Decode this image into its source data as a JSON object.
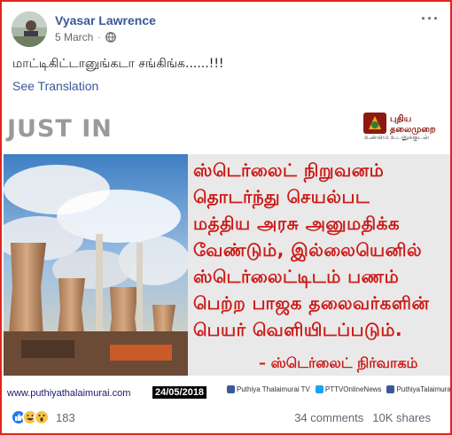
{
  "post": {
    "author": "Vyasar Lawrence",
    "date": "5 March",
    "privacy_icon": "globe-icon",
    "menu_icon": "more-options-icon",
    "text": "மாட்டிகிட்டானுங்கடா சங்கிங்க......!!!",
    "see_translation": "See Translation"
  },
  "image": {
    "just_in": "JUST IN",
    "logo_line1": "புதிய",
    "logo_line2": "தலைமுறை",
    "logo_sub": "உண்மை உடனுக்குடன்",
    "quote_lines": [
      "ஸ்டெர்லைட் நிறுவனம்",
      "தொடர்ந்து செயல்பட",
      "மத்திய அரசு அனுமதிக்க",
      "வேண்டும், இல்லையெனில்",
      "ஸ்டெர்லைட்டிடம் பணம்",
      "பெற்ற பாஜக தலைவர்களின்",
      "பெயர் வெளியிடப்படும்."
    ],
    "attribution": "– ஸ்டெர்லைட் நிர்வாகம்",
    "website": "www.puthiyathalaimurai.com",
    "date_badge": "24/05/2018",
    "social": [
      {
        "label": "Puthiya Thalaimurai TV",
        "color": "#3b5998"
      },
      {
        "label": "PTTVOnlineNews",
        "color": "#1da1f2"
      },
      {
        "label": "PuthiyaTalaimuraimagazi",
        "color": "#3b5998"
      }
    ]
  },
  "footer": {
    "reaction_count": "183",
    "comments": "34 comments",
    "shares": "10K shares"
  }
}
